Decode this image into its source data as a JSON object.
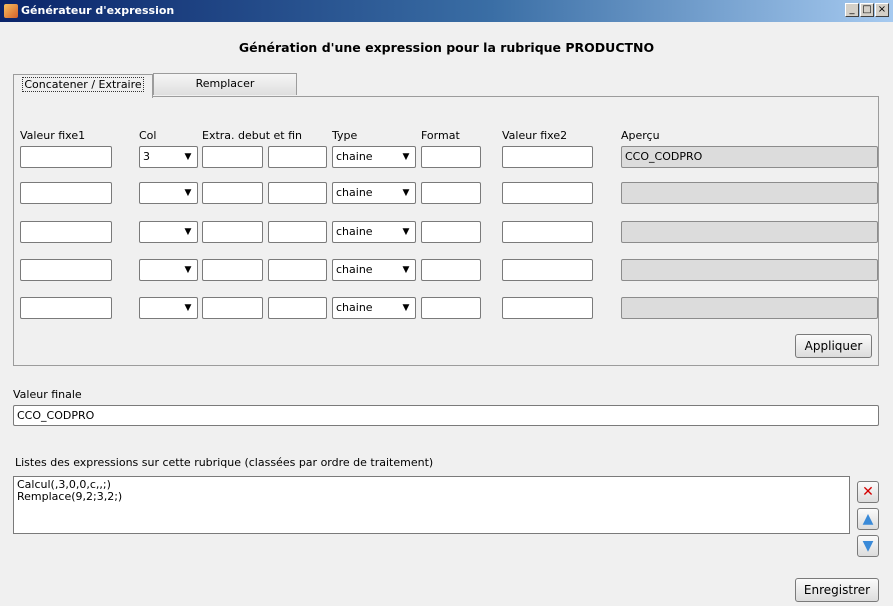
{
  "window": {
    "title": "Générateur d'expression"
  },
  "heading": "Génération d'une expression pour la rubrique  PRODUCTNO",
  "tabs": [
    {
      "label": "Concatener / Extraire",
      "active": true
    },
    {
      "label": "Remplacer",
      "active": false
    }
  ],
  "columns": {
    "valeur_fixe1": "Valeur fixe1",
    "col": "Col",
    "extra": "Extra. debut et fin",
    "type": "Type",
    "format": "Format",
    "valeur_fixe2": "Valeur fixe2",
    "apercu": "Aperçu"
  },
  "rows": [
    {
      "valeur_fixe1": "",
      "col": "3",
      "extra_debut": "",
      "extra_fin": "",
      "type": "chaine",
      "format": "",
      "valeur_fixe2": "",
      "apercu": "CCO_CODPRO"
    },
    {
      "valeur_fixe1": "",
      "col": "",
      "extra_debut": "",
      "extra_fin": "",
      "type": "chaine",
      "format": "",
      "valeur_fixe2": "",
      "apercu": ""
    },
    {
      "valeur_fixe1": "",
      "col": "",
      "extra_debut": "",
      "extra_fin": "",
      "type": "chaine",
      "format": "",
      "valeur_fixe2": "",
      "apercu": ""
    },
    {
      "valeur_fixe1": "",
      "col": "",
      "extra_debut": "",
      "extra_fin": "",
      "type": "chaine",
      "format": "",
      "valeur_fixe2": "",
      "apercu": ""
    },
    {
      "valeur_fixe1": "",
      "col": "",
      "extra_debut": "",
      "extra_fin": "",
      "type": "chaine",
      "format": "",
      "valeur_fixe2": "",
      "apercu": ""
    }
  ],
  "buttons": {
    "appliquer": "Appliquer",
    "enregistrer": "Enregistrer"
  },
  "valeur_finale": {
    "label": "Valeur finale",
    "value": "CCO_CODPRO"
  },
  "expressions": {
    "label": "Listes des expressions sur cette rubrique (classées par ordre de traitement)",
    "items": [
      "Calcul(,3,0,0,c,,;)",
      "Remplace(9,2;3,2;)"
    ]
  },
  "icons": {
    "delete": "delete-icon",
    "up": "arrow-up-icon",
    "down": "arrow-down-icon"
  },
  "colors": {
    "titlebar": "#0a246a",
    "delete": "#d40000",
    "arrows": "#3a8ad8"
  }
}
